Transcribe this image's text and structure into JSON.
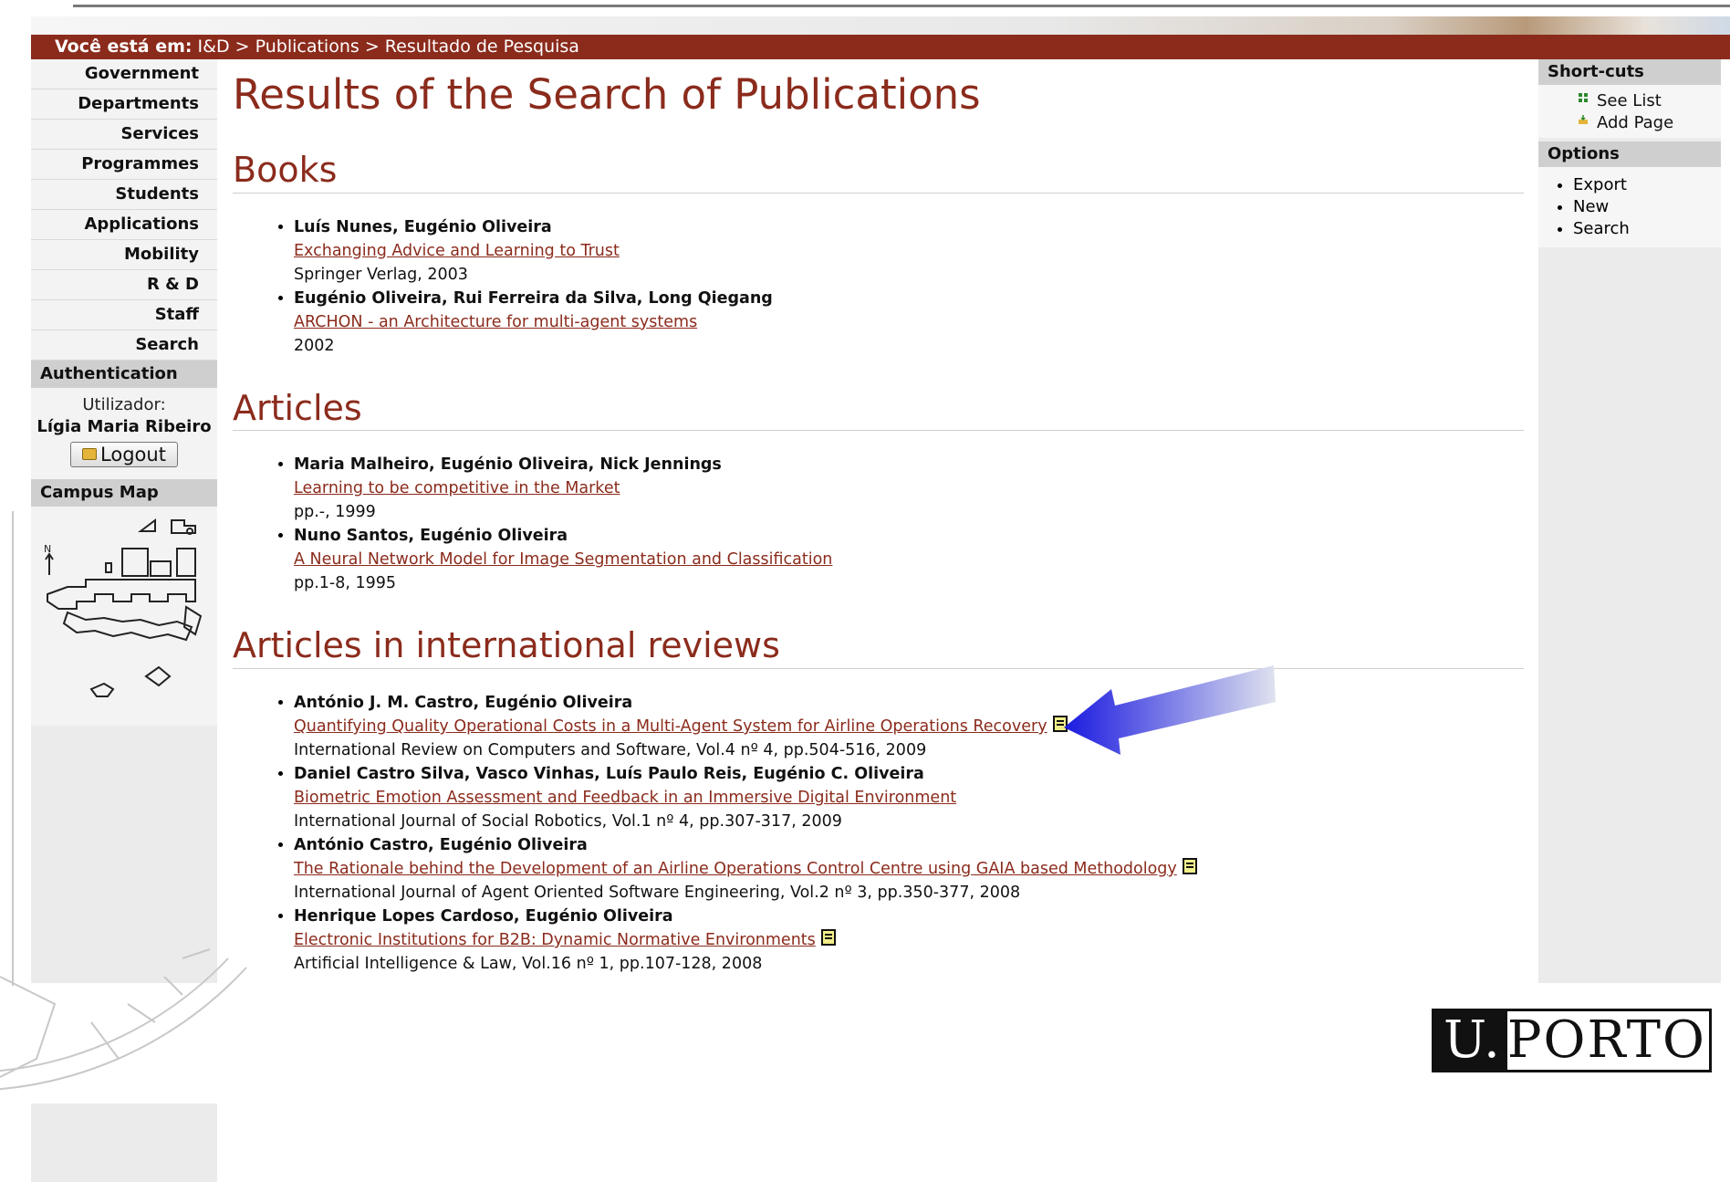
{
  "breadcrumb": {
    "lead": "Você está em:",
    "items": [
      "I&D",
      "Publications",
      "Resultado de Pesquisa"
    ],
    "sep": ">"
  },
  "leftnav": {
    "items": [
      "Government",
      "Departments",
      "Services",
      "Programmes",
      "Students",
      "Applications",
      "Mobility",
      "R & D",
      "Staff",
      "Search"
    ],
    "auth_heading": "Authentication",
    "user_label": "Utilizador:",
    "user_name": "Lígia Maria Ribeiro",
    "logout_label": "Logout",
    "map_heading": "Campus Map"
  },
  "main": {
    "title": "Results of the Search of Publications",
    "sections": [
      {
        "heading": "Books",
        "pubs": [
          {
            "authors": "Luís Nunes, Eugénio Oliveira",
            "title": "Exchanging Advice and Learning to Trust",
            "source": "Springer Verlag, 2003"
          },
          {
            "authors": "Eugénio Oliveira, Rui Ferreira da Silva, Long Qiegang",
            "title": "ARCHON - an Architecture for multi-agent systems",
            "source": "2002"
          }
        ]
      },
      {
        "heading": "Articles",
        "pubs": [
          {
            "authors": "Maria Malheiro, Eugénio Oliveira, Nick Jennings",
            "title": "Learning to be competitive in the Market",
            "source": "pp.-, 1999"
          },
          {
            "authors": "Nuno Santos, Eugénio Oliveira",
            "title": "A Neural Network Model for Image Segmentation and Classification",
            "source": "pp.1-8, 1995"
          }
        ]
      },
      {
        "heading": "Articles in international reviews",
        "pubs": [
          {
            "authors": "António J. M. Castro, Eugénio Oliveira",
            "title": "Quantifying Quality Operational Costs in a Multi-Agent System for Airline Operations Recovery",
            "source": "International Review on Computers and Software, Vol.4 nº 4, pp.504-516, 2009",
            "doc": true
          },
          {
            "authors": "Daniel Castro Silva, Vasco Vinhas, Luís Paulo Reis, Eugénio C. Oliveira",
            "title": "Biometric Emotion Assessment and Feedback in an Immersive Digital Environment",
            "source": "International Journal of Social Robotics, Vol.1 nº 4, pp.307-317, 2009",
            "doc": false
          },
          {
            "authors": "António Castro, Eugénio Oliveira",
            "title": "The Rationale behind the Development of an Airline Operations Control Centre using GAIA based Methodology",
            "source": "International Journal of Agent Oriented Software Engineering, Vol.2 nº 3, pp.350-377, 2008",
            "doc": true
          },
          {
            "authors": "Henrique Lopes Cardoso, Eugénio Oliveira",
            "title": "Electronic Institutions for B2B: Dynamic Normative Environments",
            "source": "Artificial Intelligence & Law, Vol.16 nº 1, pp.107-128, 2008",
            "doc": true
          }
        ]
      }
    ]
  },
  "rightnav": {
    "shortcuts_heading": "Short-cuts",
    "shortcuts": [
      "See List",
      "Add Page"
    ],
    "options_heading": "Options",
    "options": [
      "Export",
      "New",
      "Search"
    ]
  },
  "logo": {
    "u": "U.",
    "rest": "PORTO"
  },
  "colors": {
    "accent": "#8b2b1c",
    "panel": "#ebebeb",
    "arrow": "#2222dd"
  }
}
